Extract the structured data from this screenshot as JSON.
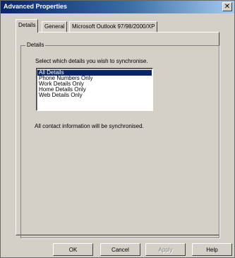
{
  "window": {
    "title": "Advanced Properties",
    "close_glyph": "✕"
  },
  "tabs": [
    {
      "label": "Details",
      "active": true
    },
    {
      "label": "General",
      "active": false
    },
    {
      "label": "Microsoft Outlook 97/98/2000/XP",
      "active": false
    }
  ],
  "details_group": {
    "legend": "Details",
    "instruction": "Select which details you wish to synchronise.",
    "options": [
      {
        "label": "All Details",
        "selected": true
      },
      {
        "label": "Phone Numbers Only",
        "selected": false
      },
      {
        "label": "Work Details Only",
        "selected": false
      },
      {
        "label": "Home Details Only",
        "selected": false
      },
      {
        "label": "Web Details Only",
        "selected": false
      }
    ],
    "summary": "All contact information will be synchronised."
  },
  "buttons": {
    "ok": "OK",
    "cancel": "Cancel",
    "apply": "Apply",
    "help": "Help"
  },
  "colors": {
    "title_bar_start": "#0a246a",
    "title_bar_end": "#a6caf0",
    "selection": "#0a246a",
    "face": "#d4d0c8"
  }
}
